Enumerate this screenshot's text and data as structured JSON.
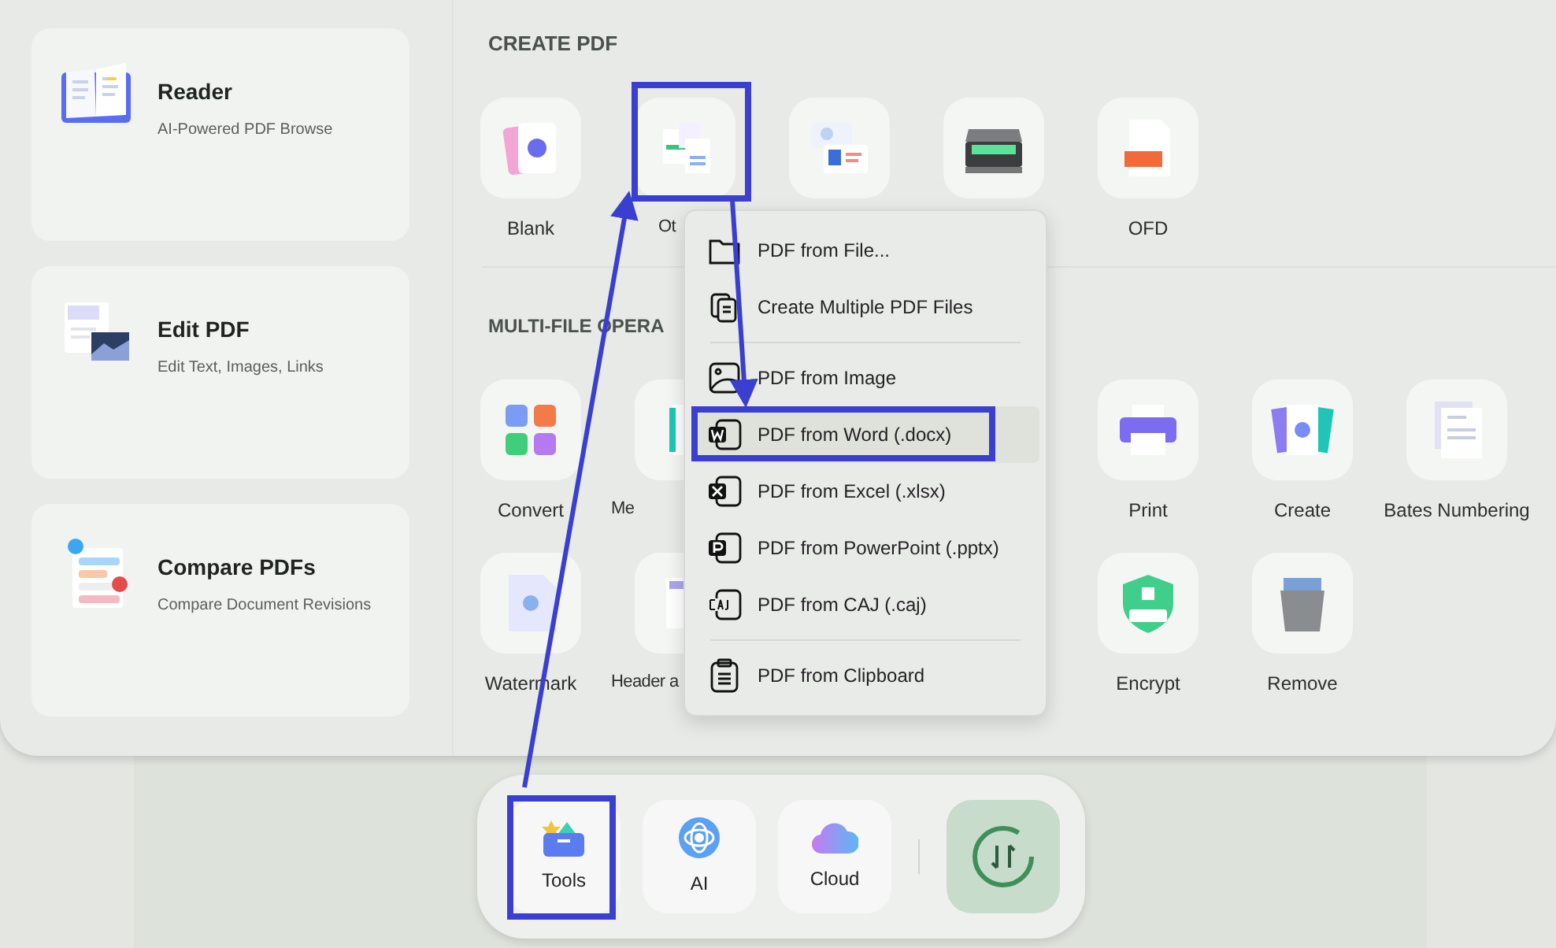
{
  "feature_cards": [
    {
      "title": "Reader",
      "subtitle": "AI-Powered PDF Browse"
    },
    {
      "title": "Edit PDF",
      "subtitle": "Edit Text, Images, Links"
    },
    {
      "title": "Compare PDFs",
      "subtitle": "Compare Document Revisions"
    }
  ],
  "create_pdf": {
    "heading": "CREATE PDF",
    "tiles": [
      {
        "kind": "tile",
        "label": "Blank"
      },
      {
        "kind": "clipped",
        "label": "Ot"
      },
      {
        "kind": "tile"
      },
      {
        "kind": "tile"
      },
      {
        "kind": "tile",
        "label": "OFD"
      }
    ]
  },
  "multi_file": {
    "heading": "MULTI-FILE OPERA",
    "rows": [
      [
        {
          "kind": "tile",
          "label": "Convert"
        },
        {
          "kind": "clipped",
          "label": "Me"
        },
        {
          "kind": "covered"
        },
        {
          "kind": "covered"
        },
        {
          "kind": "tile",
          "label": "Print"
        },
        {
          "kind": "tile",
          "label": "Create"
        },
        {
          "kind": "tile",
          "label": "Bates Numbering"
        }
      ],
      [
        {
          "kind": "tile",
          "label": "Watermark"
        },
        {
          "kind": "clipped",
          "label": "Header a"
        },
        {
          "kind": "covered"
        },
        {
          "kind": "covered"
        },
        {
          "kind": "tile",
          "label": "Encrypt"
        },
        {
          "kind": "tile",
          "label": "Remove"
        }
      ]
    ]
  },
  "menu": {
    "items": [
      {
        "kind": "item",
        "label": "PDF from File...",
        "selected": false
      },
      {
        "kind": "item",
        "label": "Create Multiple PDF Files",
        "selected": false
      },
      {
        "kind": "separator"
      },
      {
        "kind": "item",
        "label": "PDF from Image",
        "selected": false
      },
      {
        "kind": "item",
        "label": "PDF from Word (.docx)",
        "selected": true
      },
      {
        "kind": "item",
        "label": "PDF from Excel (.xlsx)",
        "selected": false
      },
      {
        "kind": "item",
        "label": "PDF from PowerPoint (.pptx)",
        "selected": false
      },
      {
        "kind": "item",
        "label": "PDF from CAJ (.caj)",
        "selected": false
      },
      {
        "kind": "separator"
      },
      {
        "kind": "item",
        "label": "PDF from Clipboard",
        "selected": false
      }
    ]
  },
  "dock": {
    "items": [
      {
        "label": "Tools"
      },
      {
        "label": "AI"
      },
      {
        "label": "Cloud"
      }
    ]
  }
}
